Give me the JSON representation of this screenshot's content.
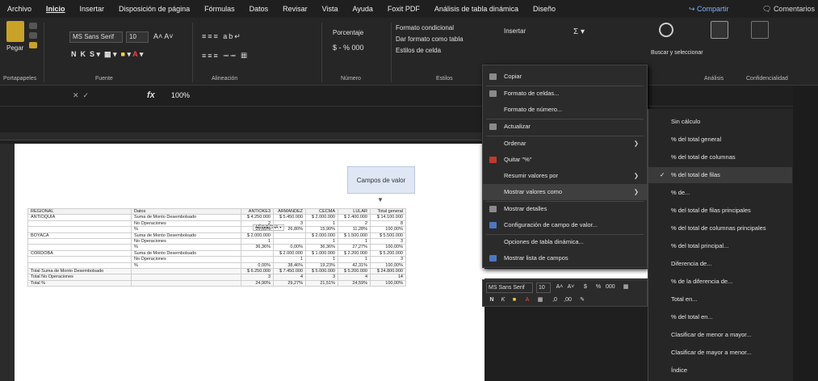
{
  "tabs": [
    "Archivo",
    "Inicio",
    "Insertar",
    "Disposición de página",
    "Fórmulas",
    "Datos",
    "Revisar",
    "Vista",
    "Ayuda",
    "Foxit PDF",
    "Análisis de tabla dinámica",
    "Diseño"
  ],
  "share_label": "Compartir",
  "comments_label": "Comentarios",
  "ribbon": {
    "paste": "Pegar",
    "font_name": "MS Sans Serif",
    "font_size": "10",
    "number_format": "Porcentaje",
    "currency_symbol": "$ - % 000",
    "cond_format": "Formato condicional",
    "table_format": "Dar formato como tabla",
    "cell_styles": "Estilos de celda",
    "insert": "Insertar",
    "find_select": "Buscar y seleccionar",
    "groups": [
      "Portapapeles",
      "Fuente",
      "Alineación",
      "Número",
      "Estilos",
      "Análisis",
      "Confidencialidad"
    ]
  },
  "formula_bar": {
    "fx": "fx",
    "value": "100%"
  },
  "value_field_drop": "Campos de valor",
  "pivot": {
    "anio_header": "AÑO/ECHA",
    "header": [
      "REGIONAL",
      "Datos",
      "ANTIOKE3",
      "ARMANDEZ",
      "CECMA",
      "LULAR",
      "Total general"
    ],
    "rows": [
      [
        "ANTIOQUIA",
        "Suma de Monto Desembolsado",
        "$ 4.250.000",
        "$ 5.450.000",
        "$ 2.000.000",
        "$ 2.400.000",
        "$ 14.100.000"
      ],
      [
        "",
        "No Operaciones",
        "2",
        "3",
        "1",
        "2",
        "8"
      ],
      [
        "",
        "%",
        "25,65%",
        "26,80%",
        "15,90%",
        "11,28%",
        "100,00%"
      ],
      [
        "BOYACÁ",
        "Suma de Monto Desembolsado",
        "$ 2.000.000",
        "",
        "$ 2.000.000",
        "$ 1.500.000",
        "$ 5.500.000"
      ],
      [
        "",
        "No Operaciones",
        "1",
        "",
        "1",
        "1",
        "3"
      ],
      [
        "",
        "%",
        "36,36%",
        "0,00%",
        "36,36%",
        "27,27%",
        "100,00%"
      ],
      [
        "CÓRDOBA",
        "Suma de Monto Desembolsado",
        "",
        "$ 2.000.000",
        "$ 1.000.000",
        "$ 2.200.000",
        "$ 5.200.000"
      ],
      [
        "",
        "No Operaciones",
        "",
        "1",
        "1",
        "1",
        "3"
      ],
      [
        "",
        "%",
        "0,00%",
        "38,46%",
        "19,23%",
        "42,31%",
        "100,00%"
      ]
    ],
    "totals": [
      [
        "Total Suma de Monto Desembolsado",
        "",
        "$ 6.250.000",
        "$ 7.450.000",
        "$ 5.000.000",
        "$ 5.200.000",
        "$ 24.800.000"
      ],
      [
        "Total No Operaciones",
        "",
        "3",
        "4",
        "3",
        "4",
        "14"
      ],
      [
        "Total %",
        "",
        "24,90%",
        "29,27%",
        "21,51%",
        "24,59%",
        "100,00%"
      ]
    ]
  },
  "context_menu": {
    "items": [
      {
        "label": "Copiar",
        "icon": "copy-icon",
        "sub": false
      },
      {
        "label": "Formato de celdas...",
        "icon": "format-cells-icon",
        "sub": false
      },
      {
        "label": "Formato de número...",
        "icon": "",
        "sub": false
      },
      {
        "label": "Actualizar",
        "icon": "refresh-icon",
        "sub": false
      },
      {
        "label": "Ordenar",
        "icon": "",
        "sub": true
      },
      {
        "label": "Quitar \"%\"",
        "icon": "remove-icon",
        "sub": false
      },
      {
        "label": "Resumir valores por",
        "icon": "",
        "sub": true
      },
      {
        "label": "Mostrar valores como",
        "icon": "",
        "sub": true
      },
      {
        "label": "Mostrar detalles",
        "icon": "details-icon",
        "sub": false
      },
      {
        "label": "Configuración de campo de valor...",
        "icon": "field-settings-icon",
        "sub": false
      },
      {
        "label": "Opciones de tabla dinámica...",
        "icon": "",
        "sub": false
      },
      {
        "label": "Mostrar lista de campos",
        "icon": "field-list-icon",
        "sub": false
      }
    ]
  },
  "mini_toolbar": {
    "font": "MS Sans Serif",
    "size": "10"
  },
  "submenu": {
    "items": [
      "Sin cálculo",
      "% del total general",
      "% del total de columnas",
      "% del total de filas",
      "% de...",
      "% del total de filas principales",
      "% del total de columnas principales",
      "% del total principal...",
      "Diferencia de...",
      "% de la diferencia de...",
      "Total en...",
      "% del total en...",
      "Clasificar de menor a mayor...",
      "Clasificar de mayor a menor...",
      "Índice"
    ],
    "checked_index": 3
  }
}
